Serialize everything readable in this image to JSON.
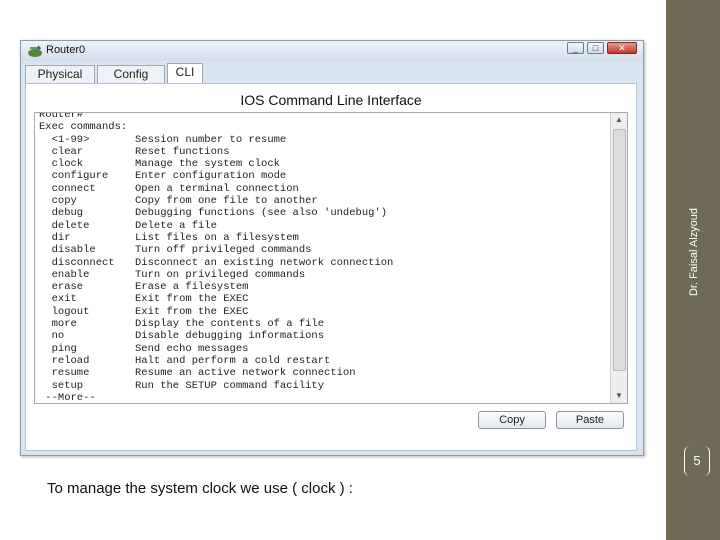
{
  "window": {
    "title": "Router0",
    "controls": {
      "minimize": "_",
      "maximize": "□",
      "close": "✕"
    }
  },
  "tabs": [
    {
      "label": "Physical"
    },
    {
      "label": "Config"
    },
    {
      "label": "CLI"
    }
  ],
  "panel": {
    "title": "IOS Command Line Interface",
    "terminal_lines": [
      {
        "cmd": "Router#",
        "desc": ""
      },
      {
        "cmd": "Exec commands:",
        "desc": ""
      },
      {
        "cmd": "  <1-99>",
        "desc": "Session number to resume"
      },
      {
        "cmd": "  clear",
        "desc": "Reset functions"
      },
      {
        "cmd": "  clock",
        "desc": "Manage the system clock"
      },
      {
        "cmd": "  configure",
        "desc": "Enter configuration mode"
      },
      {
        "cmd": "  connect",
        "desc": "Open a terminal connection"
      },
      {
        "cmd": "  copy",
        "desc": "Copy from one file to another"
      },
      {
        "cmd": "  debug",
        "desc": "Debugging functions (see also 'undebug')"
      },
      {
        "cmd": "  delete",
        "desc": "Delete a file"
      },
      {
        "cmd": "  dir",
        "desc": "List files on a filesystem"
      },
      {
        "cmd": "  disable",
        "desc": "Turn off privileged commands"
      },
      {
        "cmd": "  disconnect",
        "desc": "Disconnect an existing network connection"
      },
      {
        "cmd": "  enable",
        "desc": "Turn on privileged commands"
      },
      {
        "cmd": "  erase",
        "desc": "Erase a filesystem"
      },
      {
        "cmd": "  exit",
        "desc": "Exit from the EXEC"
      },
      {
        "cmd": "  logout",
        "desc": "Exit from the EXEC"
      },
      {
        "cmd": "  more",
        "desc": "Display the contents of a file"
      },
      {
        "cmd": "  no",
        "desc": "Disable debugging informations"
      },
      {
        "cmd": "  ping",
        "desc": "Send echo messages"
      },
      {
        "cmd": "  reload",
        "desc": "Halt and perform a cold restart"
      },
      {
        "cmd": "  resume",
        "desc": "Resume an active network connection"
      },
      {
        "cmd": "  setup",
        "desc": "Run the SETUP command facility"
      },
      {
        "cmd": " --More--",
        "desc": ""
      }
    ],
    "copy_label": "Copy",
    "paste_label": "Paste"
  },
  "slide": {
    "author": "Dr. Faisal Alzyoud",
    "page_number": "5",
    "caption": "To manage the system clock we use ( clock ) :",
    "sidebar_color": "#6f6a55"
  }
}
